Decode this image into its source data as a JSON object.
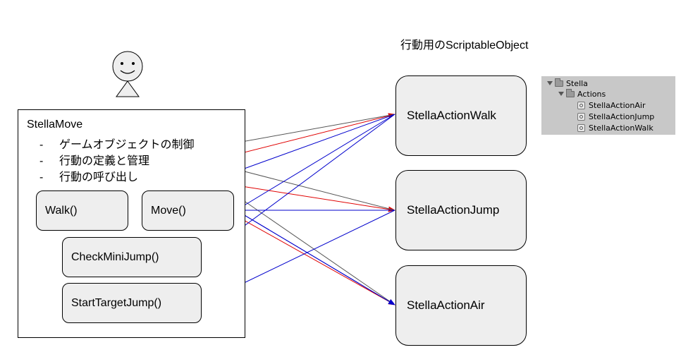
{
  "caption": "行動用のScriptableObject",
  "stella_move": {
    "title": "StellaMove",
    "bullets": [
      {
        "dash": "-",
        "text": "ゲームオブジェクトの制御"
      },
      {
        "dash": "-",
        "text": "行動の定義と管理"
      },
      {
        "dash": "-",
        "text": "行動の呼び出し"
      }
    ],
    "methods": {
      "walk": "Walk()",
      "move": "Move()",
      "check_mini_jump": "CheckMiniJump()",
      "start_target_jump": "StartTargetJump()"
    }
  },
  "actions": {
    "walk": "StellaActionWalk",
    "jump": "StellaActionJump",
    "air": "StellaActionAir"
  },
  "hierarchy": {
    "root": "Stella",
    "folder": "Actions",
    "items": [
      "StellaActionAir",
      "StellaActionJump",
      "StellaActionWalk"
    ]
  },
  "colors": {
    "red_arrow": "#e00000",
    "blue_arrow": "#0000cc",
    "gray_arrow": "#555555",
    "box_fill": "#eeeeee",
    "hierarchy_bg": "#c8c8c8"
  }
}
